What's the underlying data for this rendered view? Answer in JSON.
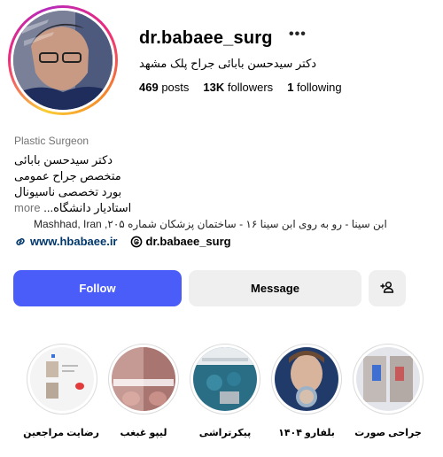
{
  "profile": {
    "username": "dr.babaee_surg",
    "more_icon": "•••",
    "full_name": "دکتر سیدحسن بابائی جراح پلک مشهد",
    "stats": {
      "posts": "469",
      "posts_label": "posts",
      "followers": "13K",
      "followers_label": "followers",
      "following": "1",
      "following_label": "following"
    },
    "category": "Plastic Surgeon",
    "bio": {
      "line1": "دکتر سیدحسن بابائی",
      "line2": "متخصص جراح عمومی",
      "line3": "بورد تخصصی ناسیونال",
      "line4": "استادیار دانشگاه...",
      "more": "more"
    },
    "address": "ابن سینا - رو به روی ابن سینا ۱۶ - ساختمان پزشکان شماره ۲۰۵, Mashhad, Iran",
    "website": "www.hbabaee.ir",
    "threads": "dr.babaee_surg",
    "icons": {
      "website": "link-icon",
      "threads": "threads-icon"
    }
  },
  "actions": {
    "follow": "Follow",
    "message": "Message",
    "add_user_icon": "add-user-icon"
  },
  "colors": {
    "follow_bg": "#4a5df9",
    "button_bg": "#efefef",
    "link": "#00376b",
    "secondary_text": "#737373"
  },
  "highlights": [
    {
      "label": "رضایت مراجعین"
    },
    {
      "label": "لیپو غبغب"
    },
    {
      "label": "پیکرتراشی"
    },
    {
      "label": "بلفارو ۱۴۰۴"
    },
    {
      "label": "جراحی صورت"
    }
  ]
}
